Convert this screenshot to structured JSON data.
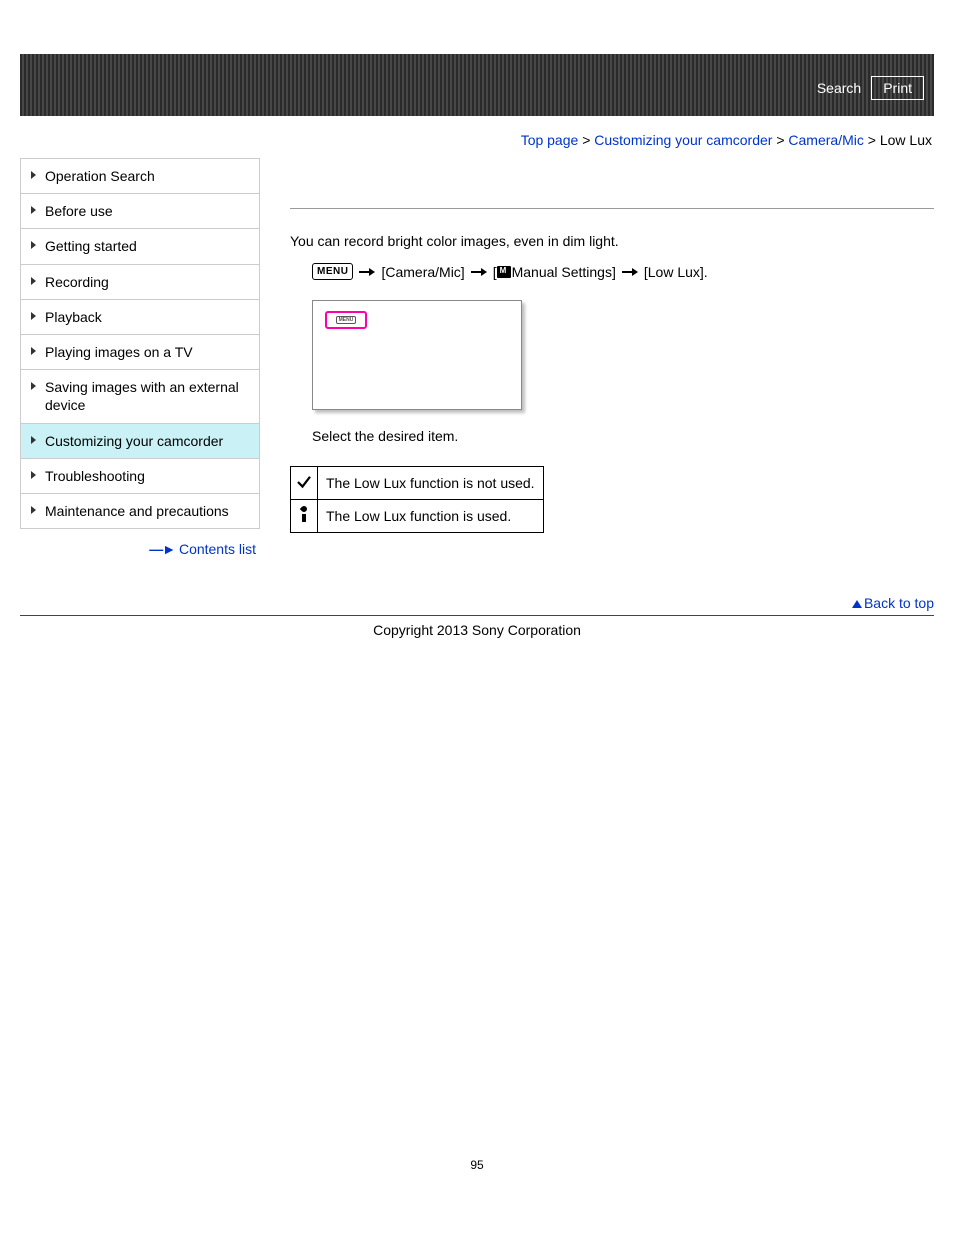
{
  "header": {
    "search_label": "Search",
    "print_label": "Print"
  },
  "breadcrumb": {
    "items": [
      "Top page",
      "Customizing your camcorder",
      "Camera/Mic"
    ],
    "current": "Low Lux"
  },
  "sidebar": {
    "items": [
      {
        "label": "Operation Search",
        "active": false
      },
      {
        "label": "Before use",
        "active": false
      },
      {
        "label": "Getting started",
        "active": false
      },
      {
        "label": "Recording",
        "active": false
      },
      {
        "label": "Playback",
        "active": false
      },
      {
        "label": "Playing images on a TV",
        "active": false
      },
      {
        "label": "Saving images with an external device",
        "active": false
      },
      {
        "label": "Customizing your camcorder",
        "active": true
      },
      {
        "label": "Troubleshooting",
        "active": false
      },
      {
        "label": "Maintenance and precautions",
        "active": false
      }
    ],
    "contents_list_label": "Contents list"
  },
  "content": {
    "intro": "You can record bright color images, even in dim light.",
    "menu_badge": "MENU",
    "path_segment_1": "[Camera/Mic]",
    "path_segment_2_prefix": "[",
    "path_segment_2_text": "Manual Settings]",
    "path_segment_3": "[Low Lux].",
    "screen_menu_inner": "MENU",
    "step_instruction": "Select the desired item.",
    "options": [
      {
        "icon": "check",
        "desc": "The Low Lux function is not used."
      },
      {
        "icon": "candle",
        "desc": "The Low Lux function is used."
      }
    ]
  },
  "footer": {
    "back_to_top": "Back to top",
    "copyright": "Copyright 2013 Sony Corporation",
    "page_number": "95"
  }
}
